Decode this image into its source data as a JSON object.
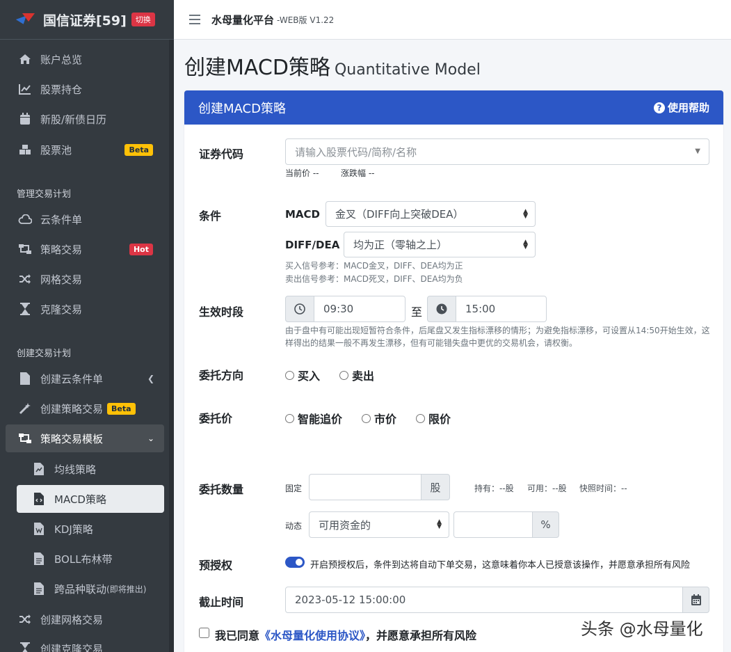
{
  "brand": {
    "title": "国信证券[59]",
    "badge": "切换"
  },
  "header": {
    "app_title": "水母量化平台",
    "app_version": "-WEB版 V1.22"
  },
  "page": {
    "title": "创建MACD策略",
    "subtitle": "Quantitative Model"
  },
  "sidebar": {
    "items": [
      {
        "label": "账户总览",
        "icon": "home-icon"
      },
      {
        "label": "股票持仓",
        "icon": "chart-line-icon"
      },
      {
        "label": "新股/新债日历",
        "icon": "calendar-icon"
      },
      {
        "label": "股票池",
        "icon": "cubes-icon",
        "badge": "Beta"
      }
    ],
    "section1": "管理交易计划",
    "items2": [
      {
        "label": "云条件单",
        "icon": "cloud-icon"
      },
      {
        "label": "策略交易",
        "icon": "sitemap-icon",
        "badge": "Hot"
      },
      {
        "label": "网格交易",
        "icon": "random-icon"
      },
      {
        "label": "克隆交易",
        "icon": "hourglass-icon"
      }
    ],
    "section2": "创建交易计划",
    "items3": [
      {
        "label": "创建云条件单",
        "icon": "file-icon"
      },
      {
        "label": "创建策略交易",
        "icon": "magic-icon",
        "badge": "Beta"
      },
      {
        "label": "策略交易模板",
        "icon": "sitemap-icon"
      }
    ],
    "sub_items": [
      {
        "label": "均线策略",
        "icon": "file-chart-icon"
      },
      {
        "label": "MACD策略",
        "icon": "file-code-icon"
      },
      {
        "label": "KDJ策略",
        "icon": "file-word-icon"
      },
      {
        "label": "BOLL布林带",
        "icon": "file-text-icon"
      },
      {
        "label": "跨品种联动",
        "label_small": "(即将推出)",
        "icon": "file-text-icon"
      }
    ],
    "items4": [
      {
        "label": "创建网格交易",
        "icon": "random-icon"
      },
      {
        "label": "创建克隆交易",
        "icon": "hourglass-icon"
      }
    ]
  },
  "card": {
    "title": "创建MACD策略",
    "help": "使用帮助"
  },
  "form": {
    "security": {
      "label": "证券代码",
      "placeholder": "请输入股票代码/简称/名称",
      "current_price": "当前价 --",
      "change": "涨跌幅 --"
    },
    "condition": {
      "label": "条件",
      "macd_label": "MACD",
      "macd_value": "金叉（DIFF向上突破DEA）",
      "diffdea_label": "DIFF/DEA",
      "diffdea_value": "均为正（零轴之上）",
      "hint_buy": "买入信号参考：MACD金叉，DIFF、DEA均为正",
      "hint_sell": "卖出信号参考：MACD死叉，DIFF、DEA均为负"
    },
    "period": {
      "label": "生效时段",
      "start": "09:30",
      "to": "至",
      "end": "15:00",
      "note": "由于盘中有可能出现短暂符合条件，后尾盘又发生指标漂移的情形；为避免指标漂移，可设置从14:50开始生效，这样得出的结果一般不再发生漂移，但有可能错失盘中更优的交易机会，请权衡。"
    },
    "direction": {
      "label": "委托方向",
      "options": [
        "买入",
        "卖出"
      ]
    },
    "price": {
      "label": "委托价",
      "options": [
        "智能追价",
        "市价",
        "限价"
      ]
    },
    "quantity": {
      "label": "委托数量",
      "fixed_label": "固定",
      "unit": "股",
      "holdings": "持有：--股",
      "available": "可用：--股",
      "snapshot": "快照时间：--",
      "dynamic_label": "动态",
      "dynamic_select": "可用资金的",
      "percent": "%"
    },
    "preauth": {
      "label": "预授权",
      "text": "开启预授权后，条件到达将自动下单交易，这意味着你本人已授意该操作，并愿意承担所有风险",
      "enabled": true
    },
    "deadline": {
      "label": "截止时间",
      "value": "2023-05-12 15:00:00"
    },
    "agree": {
      "prefix": "我已同意",
      "link": "《水母量化使用协议》",
      "suffix": "，并愿意承担所有风险"
    }
  },
  "watermark": "头条 @水母量化"
}
